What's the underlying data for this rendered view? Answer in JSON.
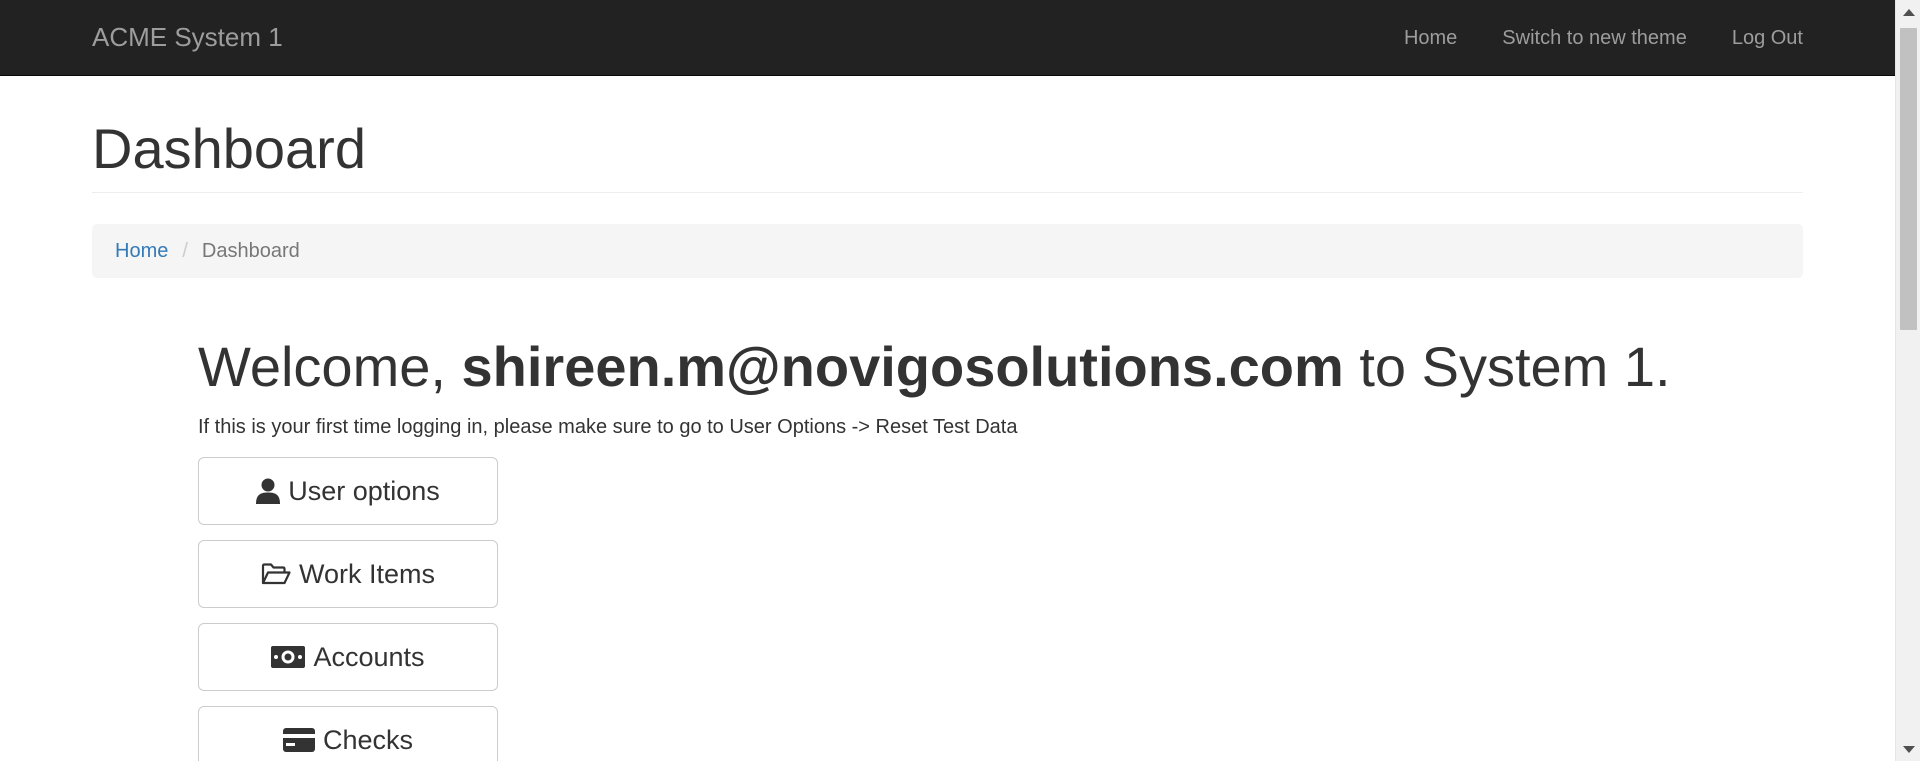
{
  "navbar": {
    "brand": "ACME System 1",
    "links": [
      "Home",
      "Switch to new theme",
      "Log Out"
    ]
  },
  "page": {
    "title": "Dashboard"
  },
  "breadcrumb": {
    "home": "Home",
    "separator": "/",
    "current": "Dashboard"
  },
  "welcome": {
    "prefix": "Welcome,",
    "user": "shireen.m@novigosolutions.com",
    "suffix": "to System 1.",
    "note": "If this is your first time logging in, please make sure to go to User Options -> Reset Test Data"
  },
  "buttons": [
    {
      "label": "User options",
      "icon": "user-icon"
    },
    {
      "label": "Work Items",
      "icon": "folder-open-icon"
    },
    {
      "label": "Accounts",
      "icon": "money-icon"
    },
    {
      "label": "Checks",
      "icon": "credit-card-icon"
    }
  ],
  "colors": {
    "navbar_bg": "#222222",
    "navbar_text": "#9d9d9d",
    "link": "#337ab7",
    "breadcrumb_bg": "#f5f5f5"
  }
}
